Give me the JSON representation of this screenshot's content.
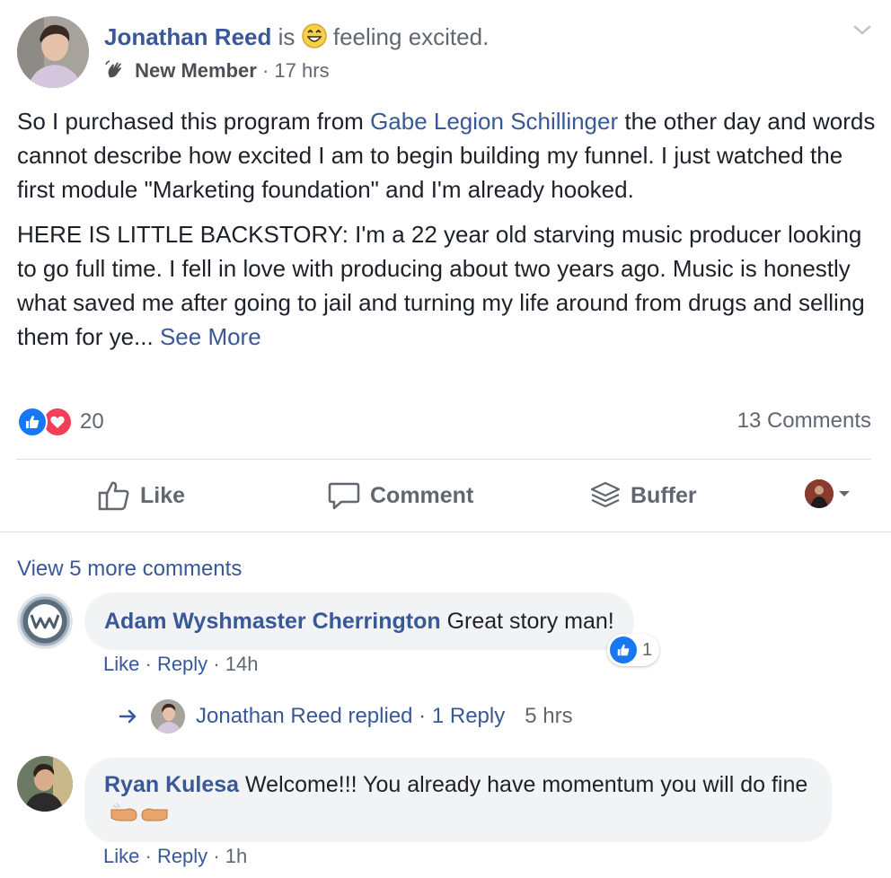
{
  "post": {
    "author": "Jonathan Reed",
    "is_text": "is",
    "feeling": "feeling excited.",
    "badge": "New Member",
    "time": "17 hrs",
    "body_pre_mention": "So I purchased this program from ",
    "mention": "Gabe Legion Schillinger",
    "body_post_mention": " the other day and words cannot describe how excited I am to begin building my funnel. I just watched the first module \"Marketing foundation\" and I'm already hooked.",
    "paragraph2": "HERE IS LITTLE BACKSTORY: I'm a 22 year old starving music producer looking to go full time. I fell in love with producing about two years ago. Music is honestly what saved me after going to jail and turning my life around from drugs and selling them for ye... ",
    "see_more": "See More",
    "reaction_count": "20",
    "comments_count": "13 Comments"
  },
  "actions": {
    "like": "Like",
    "comment": "Comment",
    "buffer": "Buffer"
  },
  "comments_section": {
    "view_more": "View 5 more comments",
    "comments": [
      {
        "name": "Adam Wyshmaster Cherrington",
        "text": "Great story man!",
        "like": "Like",
        "reply": "Reply",
        "time": "14h",
        "reaction_count": "1"
      },
      {
        "name": "Ryan Kulesa",
        "text": "Welcome!!! You already have momentum you will do fine",
        "like": "Like",
        "reply": "Reply",
        "time": "1h"
      }
    ],
    "reply_summary": {
      "text": "Jonathan Reed replied",
      "count": "1 Reply",
      "time": "5 hrs"
    }
  },
  "colors": {
    "link": "#385898",
    "like_blue": "#1877f2",
    "love_red": "#f33e58",
    "muted": "#606770",
    "bubble": "#f2f3f5"
  },
  "icons": [
    "chevron-down-icon",
    "wave-icon",
    "grin-emoji-icon",
    "like-reaction-icon",
    "love-reaction-icon",
    "thumbs-up-icon",
    "comment-icon",
    "buffer-icon",
    "caret-down-icon",
    "reply-arrow-icon",
    "fist-bump-emoji-icon"
  ]
}
